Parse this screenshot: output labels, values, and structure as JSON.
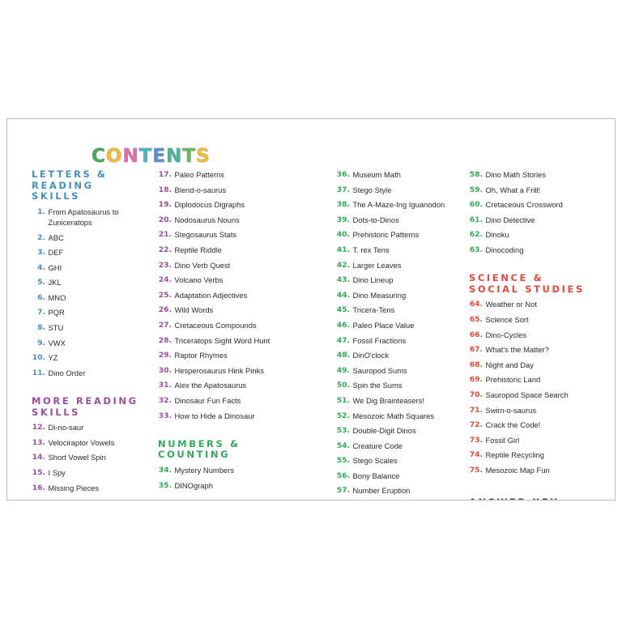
{
  "title": {
    "letters": [
      {
        "char": "C",
        "color": "#4aa85b"
      },
      {
        "char": "O",
        "color": "#f0bc3f"
      },
      {
        "char": "N",
        "color": "#e06fa8"
      },
      {
        "char": "T",
        "color": "#4bb3c4"
      },
      {
        "char": "E",
        "color": "#5b8fd0"
      },
      {
        "char": "N",
        "color": "#4bb39a"
      },
      {
        "char": "T",
        "color": "#6cb85c"
      },
      {
        "char": "S",
        "color": "#f0bc3f"
      }
    ]
  },
  "colors": {
    "letters_reading": "#4690bf",
    "more_reading": "#9b4f9e",
    "numbers_counting": "#35a85a",
    "science_social": "#e04b3d",
    "answer_key": "#4a4a4a",
    "body_text": "#2b2b2b",
    "page_border": "#b8bcbe"
  },
  "sections": {
    "letters_reading": {
      "heading": "LETTERS &\nREADING\nSKILLS"
    },
    "more_reading": {
      "heading": "MORE READING\nSKILLS"
    },
    "numbers_counting": {
      "heading": "NUMBERS &\nCOUNTING"
    },
    "science_social": {
      "heading": "SCIENCE &\nSOCIAL STUDIES"
    },
    "answer_key": {
      "heading": "ANSWER KEY"
    }
  },
  "columns": [
    {
      "id": "col1",
      "blocks": [
        {
          "heading_key": "letters_reading",
          "color_key": "letters_reading",
          "entries": [
            {
              "num": "1.",
              "text": "From Apatosaurus to Zuniceratops"
            },
            {
              "num": "2.",
              "text": "ABC"
            },
            {
              "num": "3.",
              "text": "DEF"
            },
            {
              "num": "4.",
              "text": "GHI"
            },
            {
              "num": "5.",
              "text": "JKL"
            },
            {
              "num": "6.",
              "text": "MNO"
            },
            {
              "num": "7.",
              "text": "PQR"
            },
            {
              "num": "8.",
              "text": "STU"
            },
            {
              "num": "9.",
              "text": "VWX"
            },
            {
              "num": "10.",
              "text": "YZ"
            },
            {
              "num": "11.",
              "text": "Dino Order"
            }
          ]
        },
        {
          "heading_key": "more_reading",
          "color_key": "more_reading",
          "entries": [
            {
              "num": "12.",
              "text": "Di-no-saur"
            },
            {
              "num": "13.",
              "text": "Velociraptor Vowels"
            },
            {
              "num": "14.",
              "text": "Short Vowel Spin"
            },
            {
              "num": "15.",
              "text": "I Spy"
            },
            {
              "num": "16.",
              "text": "Missing Pieces"
            }
          ]
        }
      ]
    },
    {
      "id": "col2",
      "blocks": [
        {
          "heading_key": null,
          "color_key": "more_reading",
          "entries": [
            {
              "num": "17.",
              "text": "Paleo Patterns"
            },
            {
              "num": "18.",
              "text": "Blend-o-saurus"
            },
            {
              "num": "19.",
              "text": "Diplodocus Digraphs"
            },
            {
              "num": "20.",
              "text": "Nodosaurus Nouns"
            },
            {
              "num": "21.",
              "text": "Stegosaurus Stats"
            },
            {
              "num": "22.",
              "text": "Reptile Riddle"
            },
            {
              "num": "23.",
              "text": "Dino Verb Quest"
            },
            {
              "num": "24.",
              "text": "Volcano Verbs"
            },
            {
              "num": "25.",
              "text": "Adaptation Adjectives"
            },
            {
              "num": "26.",
              "text": "Wild Words"
            },
            {
              "num": "27.",
              "text": "Cretaceous Compounds"
            },
            {
              "num": "28.",
              "text": "Triceratops Sight Word Hunt"
            },
            {
              "num": "29.",
              "text": "Raptor Rhymes"
            },
            {
              "num": "30.",
              "text": "Hesperosaurus Hink Pinks"
            },
            {
              "num": "31.",
              "text": "Alex the Apatosaurus"
            },
            {
              "num": "32.",
              "text": "Dinosaur Fun Facts"
            },
            {
              "num": "33.",
              "text": "How to Hide a Dinosaur"
            }
          ]
        },
        {
          "heading_key": "numbers_counting",
          "color_key": "numbers_counting",
          "entries": [
            {
              "num": "34.",
              "text": "Mystery Numbers"
            },
            {
              "num": "35.",
              "text": "DINOgraph"
            }
          ]
        }
      ]
    },
    {
      "id": "col3",
      "blocks": [
        {
          "heading_key": null,
          "color_key": "numbers_counting",
          "entries": [
            {
              "num": "36.",
              "text": "Museum Math"
            },
            {
              "num": "37.",
              "text": "Stego Style"
            },
            {
              "num": "38.",
              "text": "The A-Maze-Ing Iguanodon"
            },
            {
              "num": "39.",
              "text": "Dots-to-Dinos"
            },
            {
              "num": "40.",
              "text": "Prehistoric Patterns"
            },
            {
              "num": "41.",
              "text": "T. rex Tens"
            },
            {
              "num": "42.",
              "text": "Larger Leaves"
            },
            {
              "num": "43.",
              "text": "Dino Lineup"
            },
            {
              "num": "44.",
              "text": "Dino Measuring"
            },
            {
              "num": "45.",
              "text": "Tricera-Tens"
            },
            {
              "num": "46.",
              "text": "Paleo Place Value"
            },
            {
              "num": "47.",
              "text": "Fossil Fractions"
            },
            {
              "num": "48.",
              "text": "DinO'clock"
            },
            {
              "num": "49.",
              "text": "Sauropod Sums"
            },
            {
              "num": "50.",
              "text": "Spin the Sums"
            },
            {
              "num": "51.",
              "text": "We Dig Brainteasers!"
            },
            {
              "num": "52.",
              "text": "Mesozoic Math Squares"
            },
            {
              "num": "53.",
              "text": "Double-Digit Dinos"
            },
            {
              "num": "54.",
              "text": "Creature Code"
            },
            {
              "num": "55.",
              "text": "Stego Scales"
            },
            {
              "num": "56.",
              "text": "Bony Balance"
            },
            {
              "num": "57.",
              "text": "Number Eruption"
            }
          ]
        }
      ]
    },
    {
      "id": "col4",
      "blocks": [
        {
          "heading_key": null,
          "color_key": "numbers_counting",
          "entries": [
            {
              "num": "58.",
              "text": "Dino Math Stories"
            },
            {
              "num": "59.",
              "text": "Oh, What a Frill!"
            },
            {
              "num": "60.",
              "text": "Cretaceous Crossword"
            },
            {
              "num": "61.",
              "text": "Dino Detective"
            },
            {
              "num": "62.",
              "text": "Dinoku"
            },
            {
              "num": "63.",
              "text": "Dinocoding"
            }
          ]
        },
        {
          "heading_key": "science_social",
          "color_key": "science_social",
          "entries": [
            {
              "num": "64.",
              "text": "Weather or Not"
            },
            {
              "num": "65.",
              "text": "Science Sort"
            },
            {
              "num": "66.",
              "text": "Dino-Cycles"
            },
            {
              "num": "67.",
              "text": "What's the Matter?"
            },
            {
              "num": "68.",
              "text": "Night and Day"
            },
            {
              "num": "69.",
              "text": "Prehistoric Land"
            },
            {
              "num": "70.",
              "text": "Sauropod Space Search"
            },
            {
              "num": "71.",
              "text": "Swim-o-saurus"
            },
            {
              "num": "72.",
              "text": "Crack the Code!"
            },
            {
              "num": "73.",
              "text": "Fossil Girl"
            },
            {
              "num": "74.",
              "text": "Reptile Recycling"
            },
            {
              "num": "75.",
              "text": "Mesozoic Map Fun"
            }
          ]
        }
      ]
    }
  ]
}
